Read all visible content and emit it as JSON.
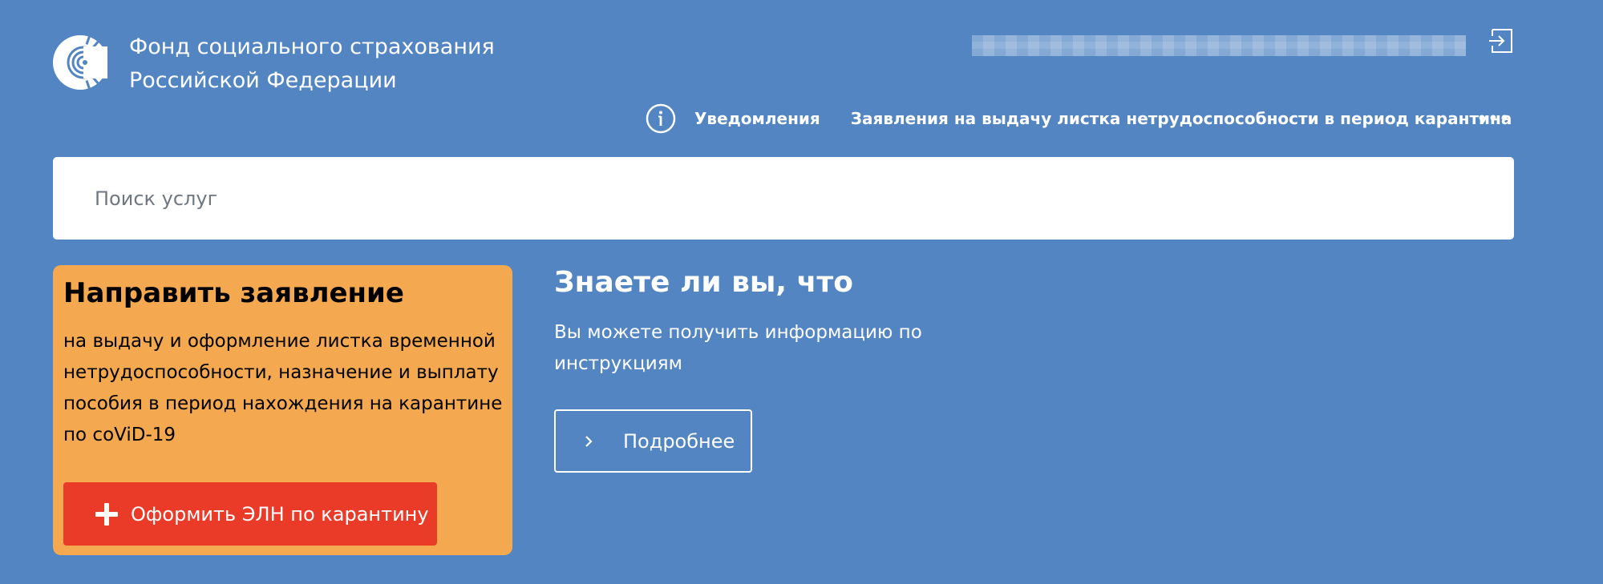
{
  "header": {
    "org_name_line1": "Фонд социального страхования",
    "org_name_line2": "Российской Федерации",
    "logo_icon": "fss-logo-icon",
    "logout_icon": "logout-icon"
  },
  "nav": {
    "info_icon": "info-icon",
    "items": [
      {
        "label": "Уведомления"
      },
      {
        "label": "Заявления на выдачу листка нетрудоспособности в период карантина"
      }
    ],
    "more_icon": "more-dots-icon"
  },
  "search": {
    "placeholder": "Поиск услуг",
    "value": ""
  },
  "apply_card": {
    "title": "Направить заявление",
    "text": "на выдачу и оформление листка временной нетрудоспособности, назначение и выплату пособия в период нахождения на карантине по coViD-19",
    "button_label": "Оформить ЭЛН по карантину",
    "button_icon": "plus-icon",
    "background_color": "#f4a950",
    "button_color": "#ea3a28"
  },
  "did_you_know": {
    "title": "Знаете ли вы, что",
    "text": "Вы можете получить информацию по инструкциям",
    "button_label": "Подробнее",
    "button_icon": "chevron-right-icon"
  },
  "colors": {
    "background": "#5285c2",
    "text": "#ffffff"
  }
}
